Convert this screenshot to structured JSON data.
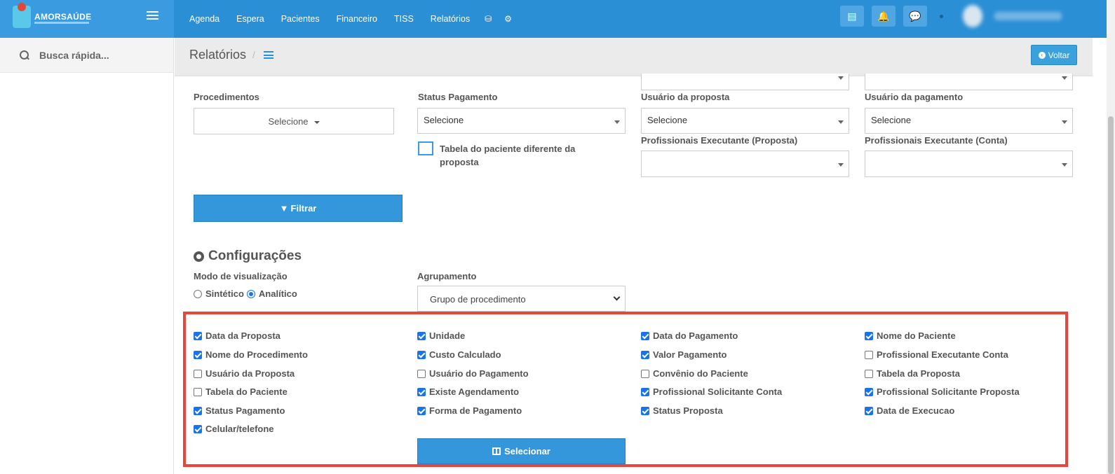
{
  "brand": {
    "name": "AMORSAÚDE"
  },
  "nav": {
    "items": [
      "Agenda",
      "Espera",
      "Pacientes",
      "Financeiro",
      "TISS",
      "Relatórios"
    ],
    "icons": [
      "database-icon",
      "gear-icon"
    ]
  },
  "topbar": {
    "icons": [
      "card-icon",
      "bell-icon",
      "chat-icon"
    ]
  },
  "sidebar": {
    "search_placeholder": "Busca rápida..."
  },
  "header": {
    "title": "Relatórios",
    "separator": "/",
    "back_label": "Voltar"
  },
  "filters": {
    "procedimentos": {
      "label": "Procedimentos",
      "value": "Selecione"
    },
    "status_pagamento": {
      "label": "Status Pagamento",
      "value": "Selecione"
    },
    "usuario_proposta": {
      "label": "Usuário da proposta",
      "value": "Selecione"
    },
    "usuario_pagamento": {
      "label": "Usuário da pagamento",
      "value": "Selecione"
    },
    "prof_exec_proposta": {
      "label": "Profissionais Executante (Proposta)",
      "value": ""
    },
    "prof_exec_conta": {
      "label": "Profissionais Executante (Conta)",
      "value": ""
    },
    "tabela_diferente": {
      "line1": "Tabela do paciente diferente da",
      "line2": "proposta",
      "checked": false
    },
    "filter_button": "Filtrar"
  },
  "config": {
    "title": "Configurações",
    "modo_label": "Modo de visualização",
    "modo_options": [
      {
        "label": "Sintético",
        "selected": false
      },
      {
        "label": "Analítico",
        "selected": true
      }
    ],
    "agrupamento_label": "Agrupamento",
    "agrupamento_value": "Grupo de procedimento"
  },
  "columns": {
    "col1": [
      {
        "label": "Data da Proposta",
        "checked": true
      },
      {
        "label": "Nome do Procedimento",
        "checked": true
      },
      {
        "label": "Usuário da Proposta",
        "checked": false
      },
      {
        "label": "Tabela do Paciente",
        "checked": false
      },
      {
        "label": "Status Pagamento",
        "checked": true
      },
      {
        "label": "Celular/telefone",
        "checked": true
      }
    ],
    "col2": [
      {
        "label": "Unidade",
        "checked": true
      },
      {
        "label": "Custo Calculado",
        "checked": true
      },
      {
        "label": "Usuário do Pagamento",
        "checked": false
      },
      {
        "label": "Existe Agendamento",
        "checked": true
      },
      {
        "label": "Forma de Pagamento",
        "checked": true
      }
    ],
    "col3": [
      {
        "label": "Data do Pagamento",
        "checked": true
      },
      {
        "label": "Valor Pagamento",
        "checked": true
      },
      {
        "label": "Convênio do Paciente",
        "checked": false
      },
      {
        "label": "Profissional Solicitante Conta",
        "checked": true
      },
      {
        "label": "Status Proposta",
        "checked": true
      }
    ],
    "col4": [
      {
        "label": "Nome do Paciente",
        "checked": true
      },
      {
        "label": "Profissional Executante Conta",
        "checked": false
      },
      {
        "label": "Tabela da Proposta",
        "checked": false
      },
      {
        "label": "Profissional Solicitante Proposta",
        "checked": true
      },
      {
        "label": "Data de Execucao",
        "checked": true
      }
    ],
    "select_button": "Selecionar"
  },
  "colors": {
    "topbar": "#2b8fd6",
    "primary_button": "#3496db",
    "highlight_border": "#e8453c"
  }
}
